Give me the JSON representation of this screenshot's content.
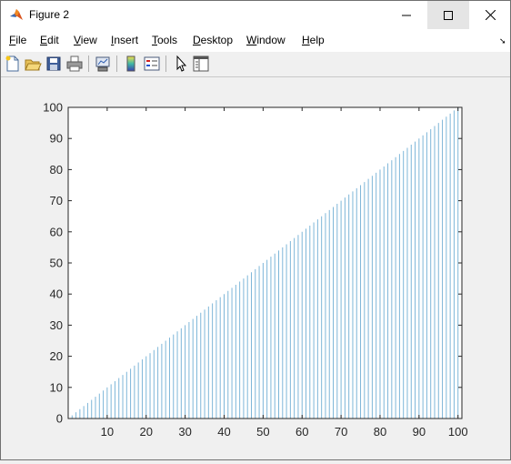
{
  "window": {
    "title": "Figure 2"
  },
  "menu": {
    "items": [
      {
        "id": "file",
        "first": "F",
        "rest": "ile"
      },
      {
        "id": "edit",
        "first": "E",
        "rest": "dit"
      },
      {
        "id": "view",
        "first": "V",
        "rest": "iew"
      },
      {
        "id": "insert",
        "first": "I",
        "rest": "nsert"
      },
      {
        "id": "tools",
        "first": "T",
        "rest": "ools"
      },
      {
        "id": "desktop",
        "first": "D",
        "rest": "esktop"
      },
      {
        "id": "window",
        "first": "W",
        "rest": "indow"
      },
      {
        "id": "help",
        "first": "H",
        "rest": "elp"
      }
    ],
    "dock_glyph": "➘"
  },
  "toolbar": {
    "buttons": [
      "new-figure-icon",
      "open-file-icon",
      "save-icon",
      "print-icon",
      "link-plot-icon",
      "colorbar-icon",
      "legend-icon",
      "edit-plot-arrow-icon",
      "property-inspector-icon"
    ]
  },
  "colors": {
    "stem": "#7eb6d8",
    "axis": "#262626",
    "plot_bg": "#ffffff",
    "figure_bg": "#f0f0f0"
  },
  "chart_data": {
    "type": "bar",
    "x": [
      1,
      2,
      3,
      4,
      5,
      6,
      7,
      8,
      9,
      10,
      11,
      12,
      13,
      14,
      15,
      16,
      17,
      18,
      19,
      20,
      21,
      22,
      23,
      24,
      25,
      26,
      27,
      28,
      29,
      30,
      31,
      32,
      33,
      34,
      35,
      36,
      37,
      38,
      39,
      40,
      41,
      42,
      43,
      44,
      45,
      46,
      47,
      48,
      49,
      50,
      51,
      52,
      53,
      54,
      55,
      56,
      57,
      58,
      59,
      60,
      61,
      62,
      63,
      64,
      65,
      66,
      67,
      68,
      69,
      70,
      71,
      72,
      73,
      74,
      75,
      76,
      77,
      78,
      79,
      80,
      81,
      82,
      83,
      84,
      85,
      86,
      87,
      88,
      89,
      90,
      91,
      92,
      93,
      94,
      95,
      96,
      97,
      98,
      99,
      100
    ],
    "values": [
      1,
      2,
      3,
      4,
      5,
      6,
      7,
      8,
      9,
      10,
      11,
      12,
      13,
      14,
      15,
      16,
      17,
      18,
      19,
      20,
      21,
      22,
      23,
      24,
      25,
      26,
      27,
      28,
      29,
      30,
      31,
      32,
      33,
      34,
      35,
      36,
      37,
      38,
      39,
      40,
      41,
      42,
      43,
      44,
      45,
      46,
      47,
      48,
      49,
      50,
      51,
      52,
      53,
      54,
      55,
      56,
      57,
      58,
      59,
      60,
      61,
      62,
      63,
      64,
      65,
      66,
      67,
      68,
      69,
      70,
      71,
      72,
      73,
      74,
      75,
      76,
      77,
      78,
      79,
      80,
      81,
      82,
      83,
      84,
      85,
      86,
      87,
      88,
      89,
      90,
      91,
      92,
      93,
      94,
      95,
      96,
      97,
      98,
      99,
      100
    ],
    "title": "",
    "xlabel": "",
    "ylabel": "",
    "xlim": [
      0,
      101
    ],
    "ylim": [
      0,
      100
    ],
    "xticks": [
      10,
      20,
      30,
      40,
      50,
      60,
      70,
      80,
      90,
      100
    ],
    "yticks": [
      0,
      10,
      20,
      30,
      40,
      50,
      60,
      70,
      80,
      90,
      100
    ],
    "grid": false
  }
}
